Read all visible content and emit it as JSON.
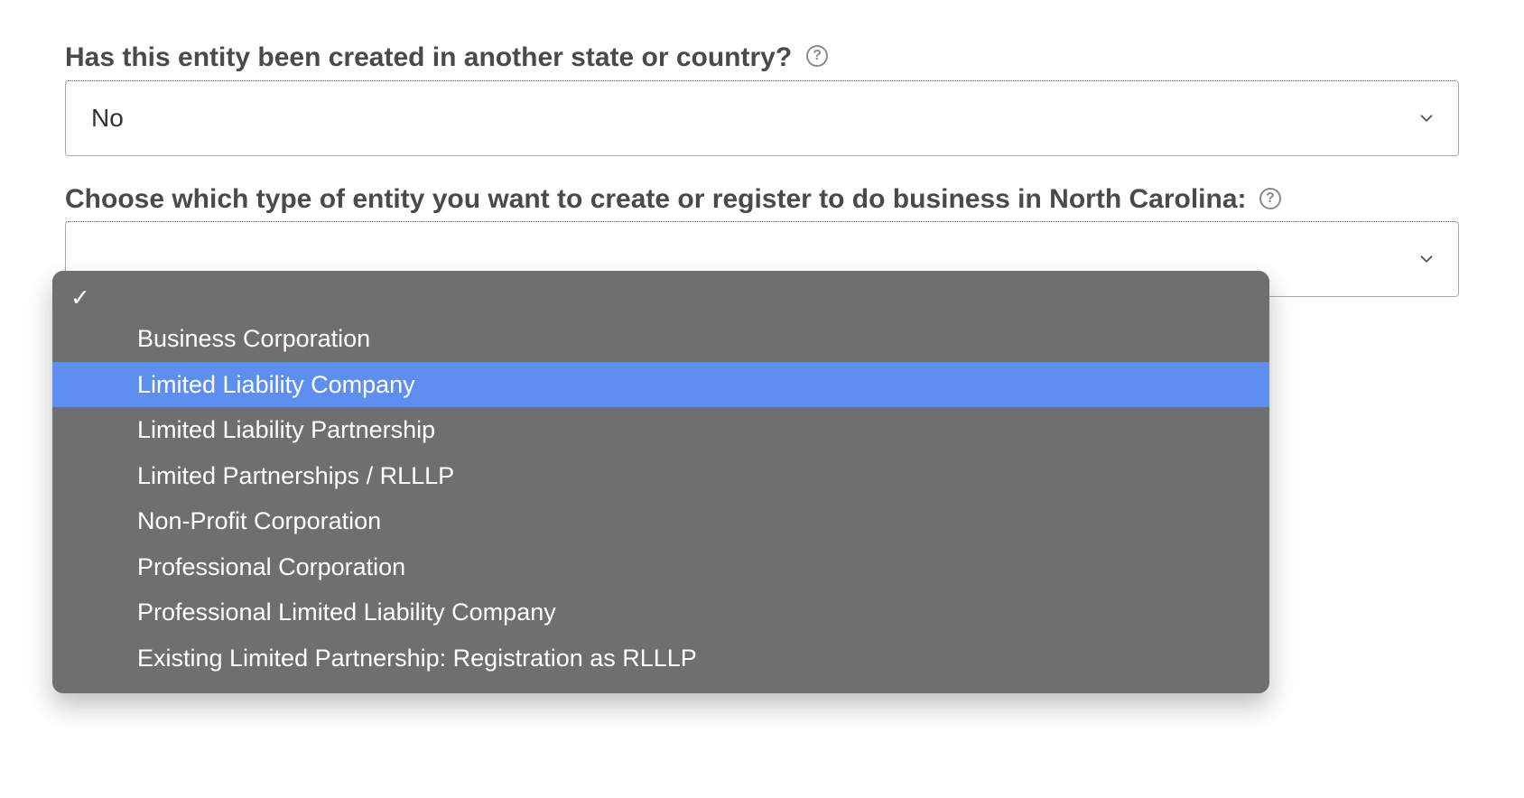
{
  "field1": {
    "label": "Has this entity been created in another state or country?",
    "value": "No",
    "help_glyph": "?"
  },
  "field2": {
    "label": "Choose which type of entity you want to create or register to do business in North Carolina:",
    "help_glyph": "?",
    "selected": "",
    "options": [
      "",
      "Business Corporation",
      "Limited Liability Company",
      "Limited Liability Partnership",
      "Limited Partnerships / RLLLP",
      "Non-Profit Corporation",
      "Professional Corporation",
      "Professional Limited Liability Company",
      "Existing Limited Partnership: Registration as RLLLP"
    ],
    "highlighted_index": 2,
    "checked_index": 0,
    "check_glyph": "✓"
  }
}
